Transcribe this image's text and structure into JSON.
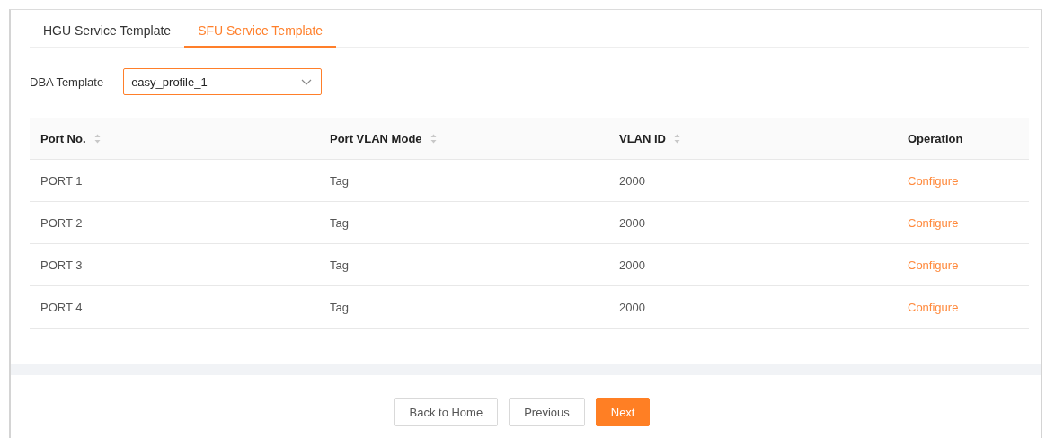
{
  "tabs": [
    {
      "label": "HGU Service Template",
      "selected": false
    },
    {
      "label": "SFU Service Template",
      "selected": true
    }
  ],
  "dba_template": {
    "label": "DBA Template",
    "value": "easy_profile_1"
  },
  "table": {
    "columns": [
      {
        "label": "Port No.",
        "sortable": true
      },
      {
        "label": "Port VLAN Mode",
        "sortable": true
      },
      {
        "label": "VLAN ID",
        "sortable": true
      },
      {
        "label": "Operation",
        "sortable": false
      }
    ],
    "rows": [
      {
        "port": "PORT 1",
        "mode": "Tag",
        "vlan_id": "2000",
        "action": "Configure"
      },
      {
        "port": "PORT 2",
        "mode": "Tag",
        "vlan_id": "2000",
        "action": "Configure"
      },
      {
        "port": "PORT 3",
        "mode": "Tag",
        "vlan_id": "2000",
        "action": "Configure"
      },
      {
        "port": "PORT 4",
        "mode": "Tag",
        "vlan_id": "2000",
        "action": "Configure"
      }
    ]
  },
  "buttons": [
    {
      "label": "Back to Home",
      "kind": "default"
    },
    {
      "label": "Previous",
      "kind": "default"
    },
    {
      "label": "Next",
      "kind": "primary"
    }
  ]
}
